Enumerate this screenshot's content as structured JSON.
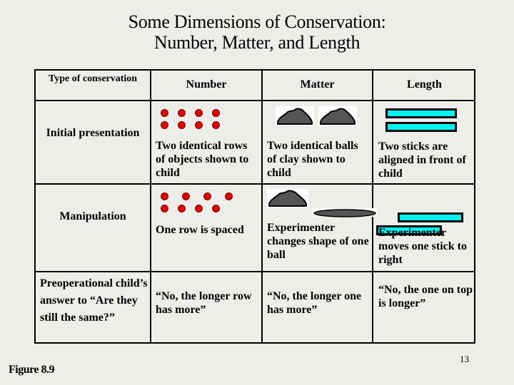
{
  "title": {
    "line1": "Some Dimensions of Conservation:",
    "line2": "Number, Matter, and Length"
  },
  "table": {
    "headers": {
      "type": "Type of conservation",
      "number": "Number",
      "matter": "Matter",
      "length": "Length"
    },
    "rows": [
      {
        "label": "Initial presentation",
        "number": "Two identical rows of objects shown to child",
        "matter": "Two identical balls of clay shown to child",
        "length": "Two sticks are aligned in front of child"
      },
      {
        "label": "Manipulation",
        "number": "One row is spaced",
        "matter": "Experimenter changes shape of one ball",
        "length": "Experimenter moves one stick to right"
      },
      {
        "label": "Preoperational child’s answer to “Are they still the same?”",
        "number": "“No, the longer row has more”",
        "matter": "“No, the longer one has more”",
        "length": "“No, the one on top is longer”"
      }
    ],
    "illustrations": {
      "dot_icon": "red-dot",
      "clay_icon": "clay-ball",
      "flat_clay_icon": "flattened-clay",
      "stick_icon": "cyan-stick",
      "dots_per_row": 4
    }
  },
  "colors": {
    "background": "#ededea",
    "dot": "#e00000",
    "clay": "#555555",
    "stick": "#00f4f4"
  },
  "footer": {
    "page_number": "13",
    "figure_label": "Figure 8.9"
  }
}
